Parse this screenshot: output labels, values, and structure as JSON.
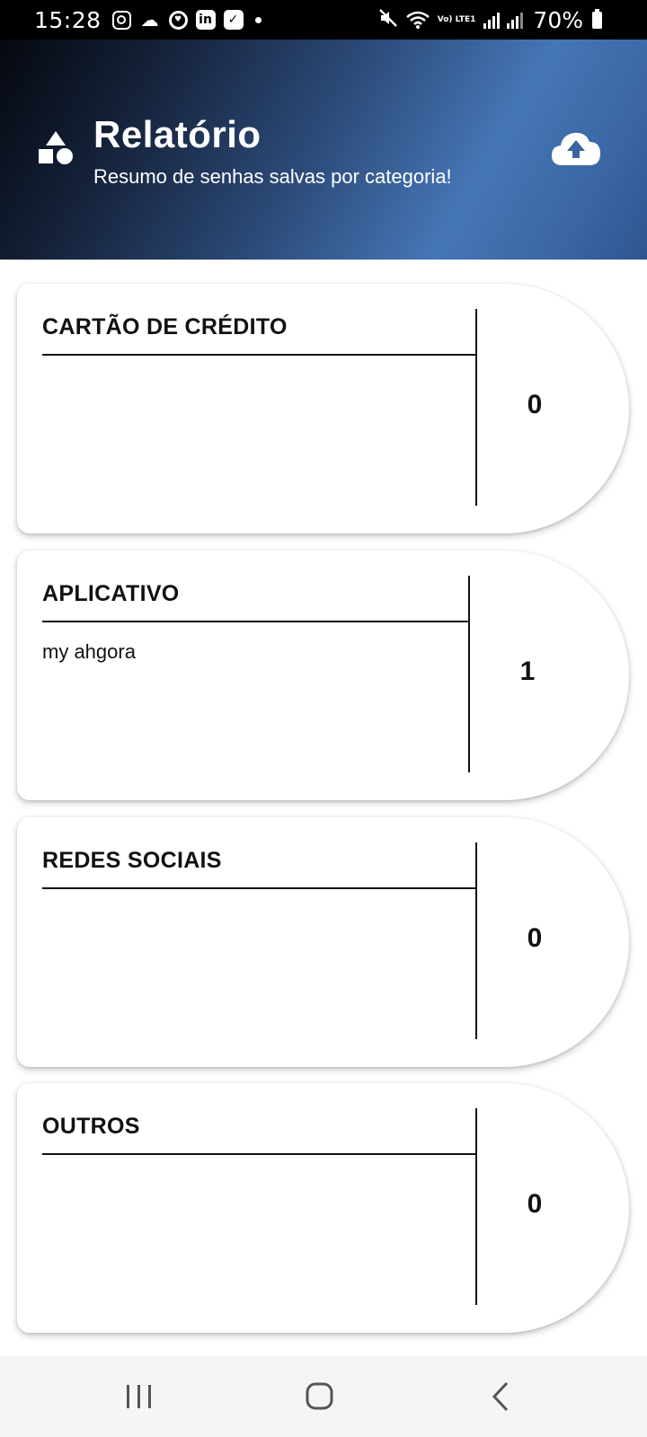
{
  "status_bar": {
    "time": "15:28",
    "battery": "70%",
    "network_label": "Vo) LTE1",
    "icons": [
      "instagram-icon",
      "cloud-icon",
      "linkedin-icon",
      "check-icon",
      "mute-icon",
      "wifi-icon",
      "signal-icon",
      "battery-icon"
    ]
  },
  "header": {
    "title": "Relatório",
    "subtitle": "Resumo de senhas salvas por categoria!",
    "left_icon": "shapes-icon",
    "right_icon": "cloud-upload-icon",
    "gradient_colors": [
      "#05080f",
      "#2c4a78",
      "#4576b6"
    ]
  },
  "categories": [
    {
      "title": "CARTÃO DE CRÉDITO",
      "items": [],
      "count": "0"
    },
    {
      "title": "APLICATIVO",
      "items": [
        "my ahgora"
      ],
      "count": "1"
    },
    {
      "title": "REDES SOCIAIS",
      "items": [],
      "count": "0"
    },
    {
      "title": "OUTROS",
      "items": [],
      "count": "0"
    }
  ],
  "nav": {
    "buttons": [
      "recents-icon",
      "home-icon",
      "back-icon"
    ]
  }
}
